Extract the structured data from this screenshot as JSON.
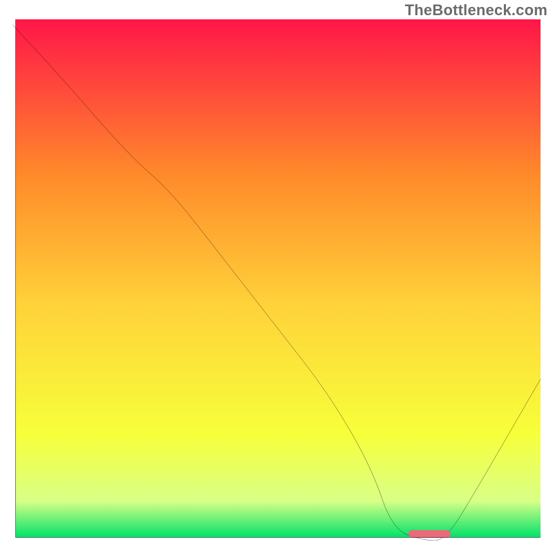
{
  "watermark": "TheBottleneck.com",
  "colors": {
    "gradient_top": "#ff1649",
    "gradient_upper_mid": "#ff8a2a",
    "gradient_mid": "#ffd23a",
    "gradient_lower_mid": "#f7ff3a",
    "gradient_low": "#d8ff86",
    "gradient_bottom": "#00e26a",
    "curve": "#000000",
    "axis": "#000000",
    "marker": "#e96a7a"
  },
  "chart_data": {
    "type": "line",
    "title": "",
    "xlabel": "",
    "ylabel": "",
    "xlim": [
      0,
      100
    ],
    "ylim": [
      0,
      100
    ],
    "series": [
      {
        "name": "bottleneck-curve",
        "x": [
          0,
          10,
          22,
          30,
          40,
          50,
          60,
          68,
          72,
          78,
          82,
          88,
          100
        ],
        "y": [
          99,
          88,
          74,
          67,
          54,
          41,
          28,
          14,
          2,
          0,
          0,
          10,
          31
        ]
      }
    ],
    "marker": {
      "name": "optimal-range",
      "x_start": 75,
      "x_end": 83,
      "y": 0
    },
    "grid": false,
    "legend": false
  }
}
